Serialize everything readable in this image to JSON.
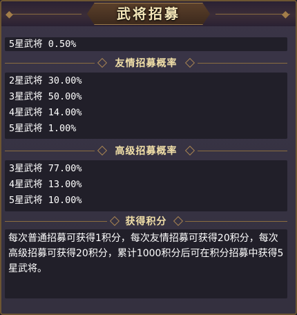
{
  "title": "武将招募",
  "top_rows": [
    "5星武将 0.50%"
  ],
  "friend_section": {
    "title": "友情招募概率",
    "rows": [
      "2星武将 30.00%",
      "3星武将 50.00%",
      "4星武将 14.00%",
      "5星武将 1.00%"
    ]
  },
  "advanced_section": {
    "title": "高级招募概率",
    "rows": [
      "3星武将 77.00%",
      "4星武将 13.00%",
      "5星武将 10.00%"
    ]
  },
  "points_section": {
    "title": "获得积分",
    "description": "每次普通招募可获得1积分，每次友情招募可获得20积分，每次高级招募可获得20积分，累计1000积分后可在积分招募中获得5星武将。"
  }
}
